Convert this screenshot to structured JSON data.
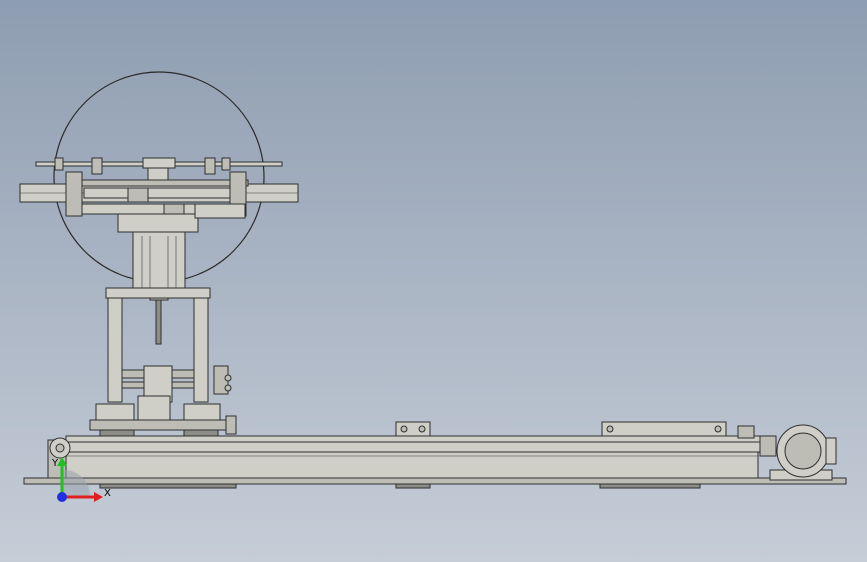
{
  "viewport": {
    "background_top": "#8e9db1",
    "background_bottom": "#c6cdd7"
  },
  "triad": {
    "x_label": "X",
    "y_label": "Y",
    "x_color": "#e02020",
    "y_color": "#20c020",
    "z_color": "#2030e0"
  }
}
